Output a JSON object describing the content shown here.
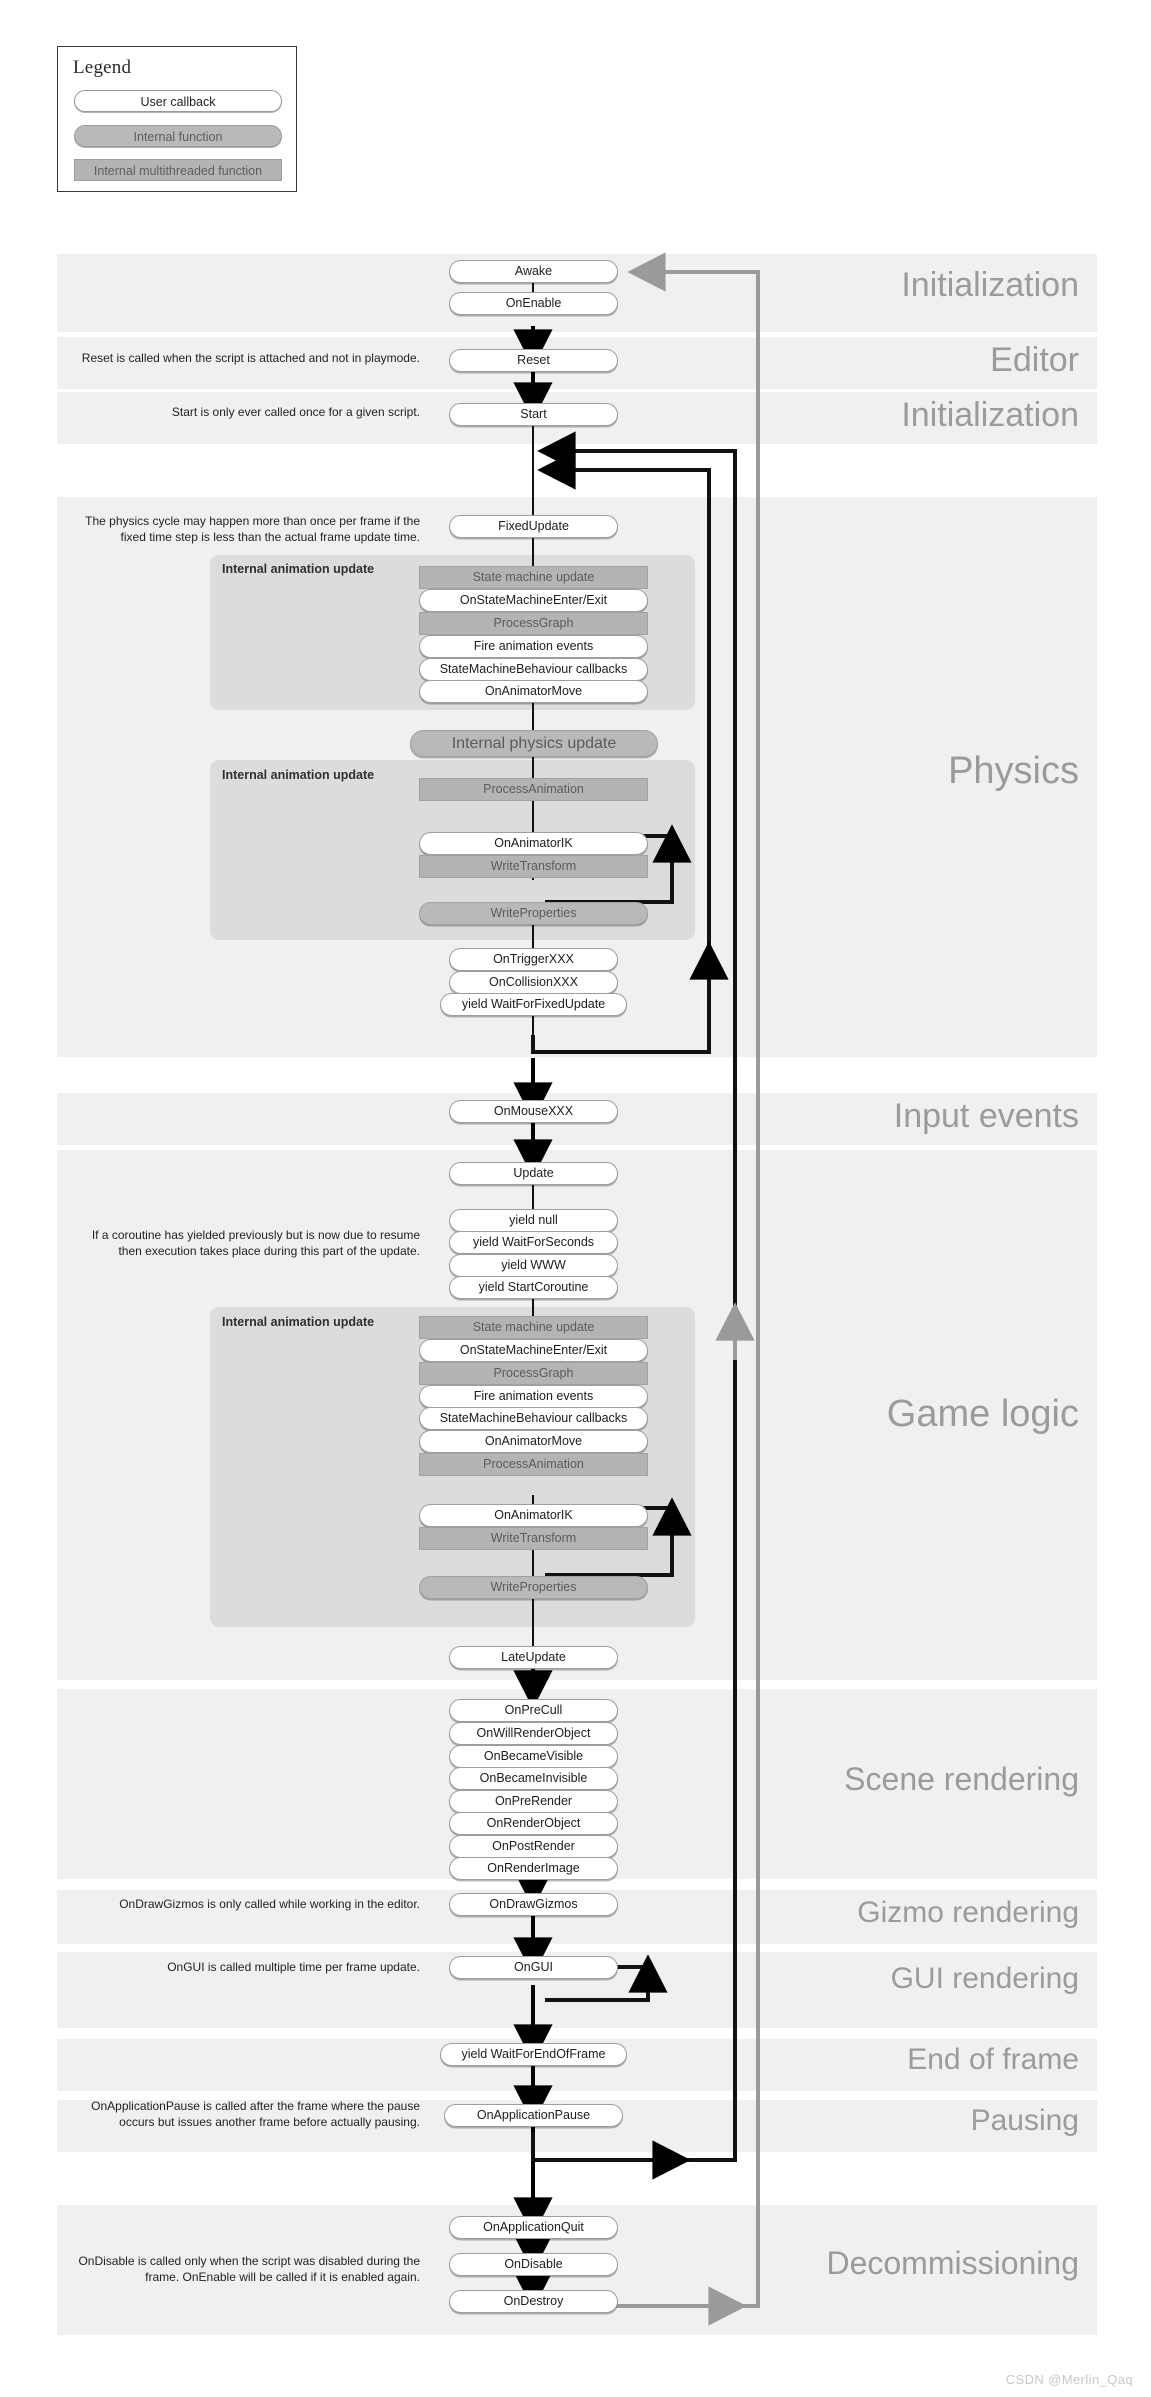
{
  "legend": {
    "title": "Legend",
    "items": [
      {
        "label": "User callback",
        "kind": "user"
      },
      {
        "label": "Internal function",
        "kind": "internal"
      },
      {
        "label": "Internal multithreaded function",
        "kind": "multi"
      }
    ]
  },
  "sections": [
    {
      "id": "initialization-1",
      "label": "Initialization"
    },
    {
      "id": "editor",
      "label": "Editor"
    },
    {
      "id": "initialization-2",
      "label": "Initialization"
    },
    {
      "id": "physics",
      "label": "Physics"
    },
    {
      "id": "input-events",
      "label": "Input events"
    },
    {
      "id": "game-logic",
      "label": "Game logic"
    },
    {
      "id": "scene-rendering",
      "label": "Scene rendering"
    },
    {
      "id": "gizmo-rendering",
      "label": "Gizmo rendering"
    },
    {
      "id": "gui-rendering",
      "label": "GUI rendering"
    },
    {
      "id": "end-of-frame",
      "label": "End of frame"
    },
    {
      "id": "pausing",
      "label": "Pausing"
    },
    {
      "id": "decommissioning",
      "label": "Decommissioning"
    }
  ],
  "notes": {
    "reset": "Reset is called when the script is attached and not in playmode.",
    "start": "Start is only ever called once for a given script.",
    "fixedupdate": "The physics cycle may happen more than once per frame if the fixed time step is less than the actual frame update time.",
    "coroutine": "If a coroutine has yielded previously but is now due to resume then execution takes place during this part of the update.",
    "gizmos": "OnDrawGizmos is only called while working in the editor.",
    "ongui": "OnGUI is called multiple time per frame update.",
    "pause": "OnApplicationPause is called after the frame where the pause occurs but issues another frame before actually pausing.",
    "ondisable": "OnDisable is called only when the script was disabled during the frame. OnEnable will be called if it is enabled again."
  },
  "groups": {
    "anim_physics_1": "Internal animation update",
    "anim_physics_2": "Internal animation update",
    "anim_gamelogic": "Internal animation update"
  },
  "nodes": {
    "awake": "Awake",
    "onenable": "OnEnable",
    "reset": "Reset",
    "start": "Start",
    "fixedupdate": "FixedUpdate",
    "p_state_machine_update": "State machine update",
    "p_onstatemachine": "OnStateMachineEnter/Exit",
    "p_processgraph": "ProcessGraph",
    "p_fireanimevents": "Fire animation events",
    "p_smbcallbacks": "StateMachineBehaviour callbacks",
    "p_onanimatormove": "OnAnimatorMove",
    "internal_physics_update": "Internal physics update",
    "p2_processanimation": "ProcessAnimation",
    "p2_onanimatorik": "OnAnimatorIK",
    "p2_writetransform": "WriteTransform",
    "p2_writeproperties": "WriteProperties",
    "ontriggerxxx": "OnTriggerXXX",
    "oncollisionxxx": "OnCollisionXXX",
    "yieldwaitforfixedupdate": "yield WaitForFixedUpdate",
    "onmousexxx": "OnMouseXXX",
    "update": "Update",
    "yieldnull": "yield null",
    "yieldwaitforseconds": "yield WaitForSeconds",
    "yieldwww": "yield WWW",
    "yieldstartcoroutine": "yield StartCoroutine",
    "g_state_machine_update": "State machine update",
    "g_onstatemachine": "OnStateMachineEnter/Exit",
    "g_processgraph": "ProcessGraph",
    "g_fireanimevents": "Fire animation events",
    "g_smbcallbacks": "StateMachineBehaviour callbacks",
    "g_onanimatormove": "OnAnimatorMove",
    "g_processanimation": "ProcessAnimation",
    "g_onanimatorik": "OnAnimatorIK",
    "g_writetransform": "WriteTransform",
    "g_writeproperties": "WriteProperties",
    "lateupdate": "LateUpdate",
    "onprecull": "OnPreCull",
    "onwillrenderobject": "OnWillRenderObject",
    "onbecamevisible": "OnBecameVisible",
    "onbecameinvisible": "OnBecameInvisible",
    "onprerender": "OnPreRender",
    "onrenderobject": "OnRenderObject",
    "onpostrender": "OnPostRender",
    "onrenderimage": "OnRenderImage",
    "ondrawgizmos": "OnDrawGizmos",
    "ongui": "OnGUI",
    "yieldwaitforendofframe": "yield WaitForEndOfFrame",
    "onapplicationpause": "OnApplicationPause",
    "onapplicationquit": "OnApplicationQuit",
    "ondisable": "OnDisable",
    "ondestroy": "OnDestroy"
  },
  "watermark": "CSDN @Merlin_Qaq",
  "colors": {
    "band": "#f0f0f0",
    "group": "#dcdcdc",
    "internal": "#b9b9b9",
    "multithreaded": "#b4b4b4",
    "user": "#ffffff",
    "section_label": "#9b9b9b",
    "flow_line": "#000000",
    "restart_line": "#999999"
  }
}
